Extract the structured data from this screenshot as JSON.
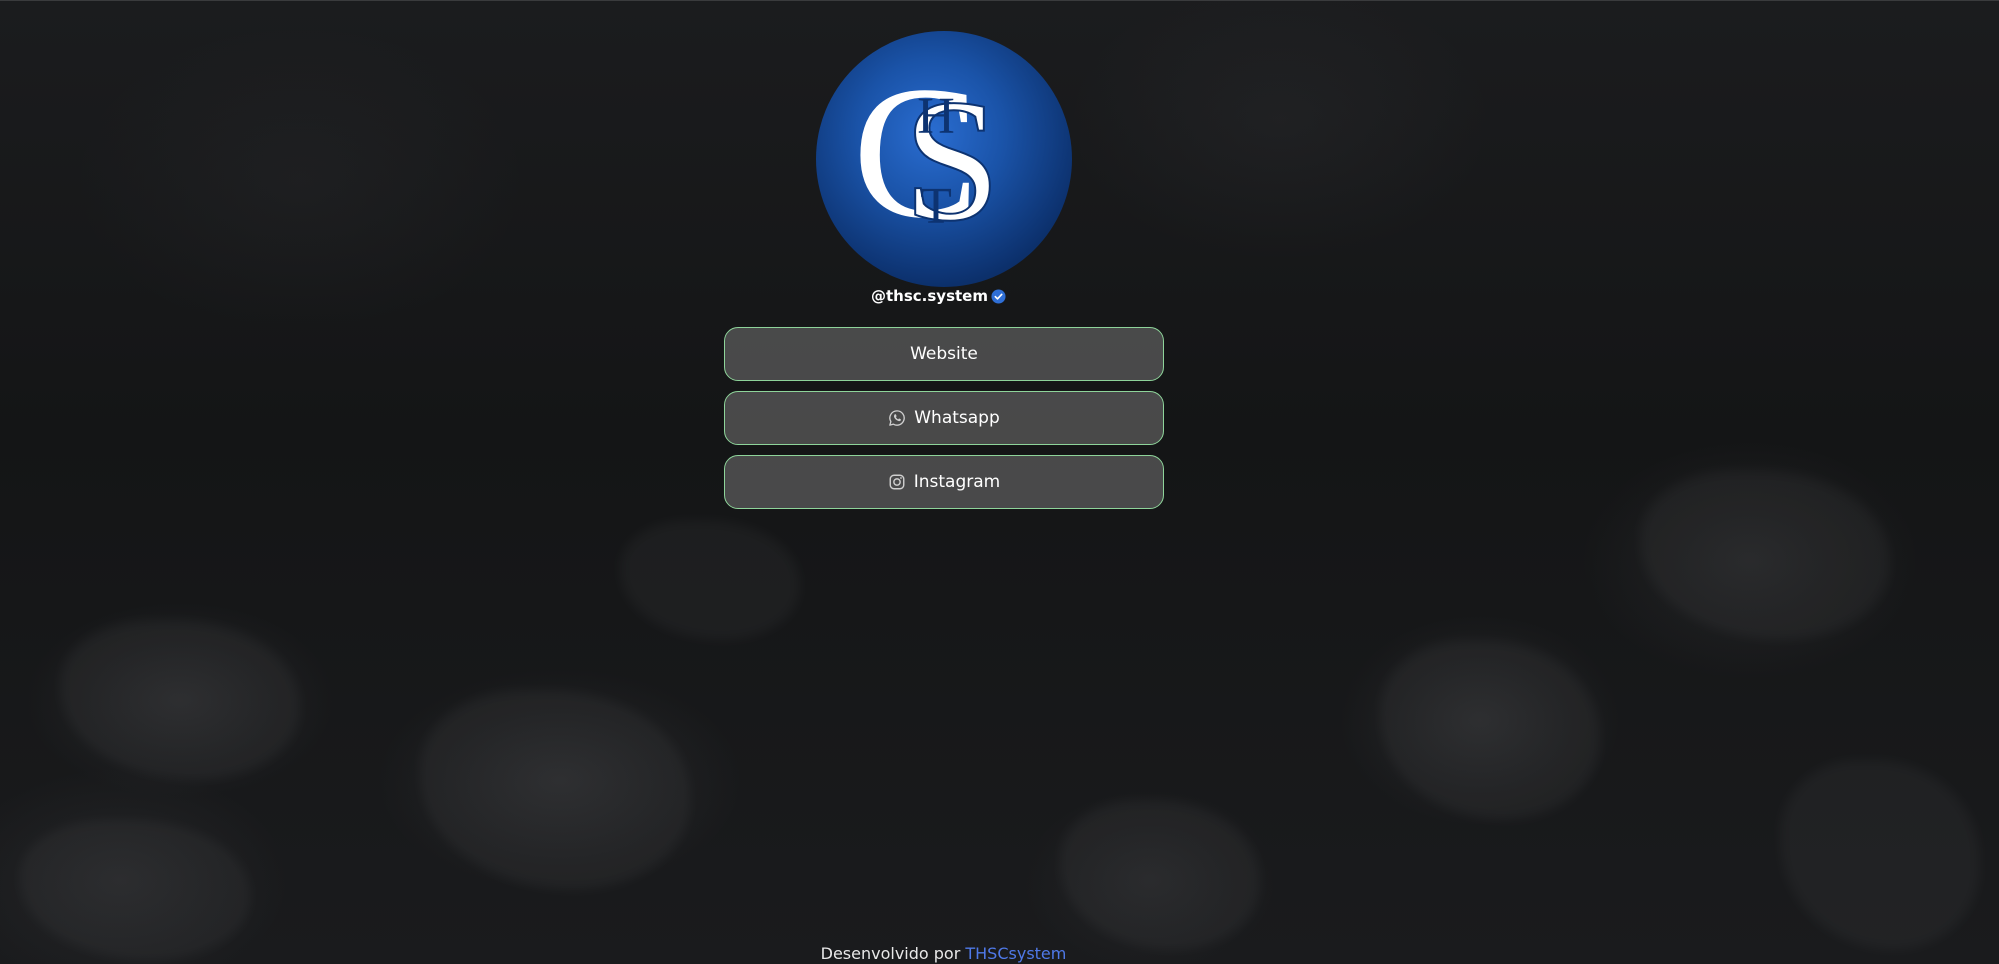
{
  "profile": {
    "handle": "@thsc.system",
    "avatar_monogram": "THSC",
    "verified_icon": "verified-check-icon"
  },
  "links": [
    {
      "label": "Website",
      "icon": null
    },
    {
      "label": "Whatsapp",
      "icon": "whatsapp-icon"
    },
    {
      "label": "Instagram",
      "icon": "instagram-icon"
    }
  ],
  "footer": {
    "prefix": "Desenvolvido por",
    "link_text": "THSCsystem"
  },
  "colors": {
    "background": "#161718",
    "button_bg": "#585858",
    "button_border": "#8ed49a",
    "footer_link": "#4f79e8",
    "avatar_blue": "#1a53a8"
  }
}
